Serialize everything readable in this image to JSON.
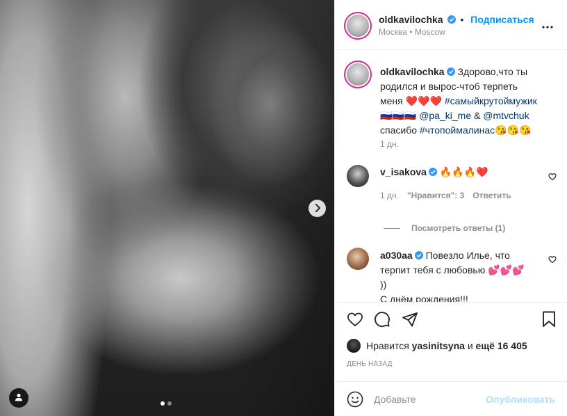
{
  "post_author": {
    "username": "oldkavilochka",
    "follow_label": "Подписаться",
    "location": "Москва • Moscow"
  },
  "caption": {
    "username": "oldkavilochka",
    "text_line1": "Здорово,что ты родился и вырос-чтоб терпеть меня",
    "hearts": "❤️❤️❤️",
    "hashtag1": "#самыйкрутоймужик",
    "flags": "🇷🇺🇷🇺🇷🇺",
    "mention1": "@pa_ki_me",
    "and": "&",
    "mention2": "@mtvchuk",
    "thanks": "спасибо",
    "hashtag2": "#чтопоймалинас",
    "kisses": "😘😘😘",
    "time": "1 дн."
  },
  "comments": [
    {
      "username": "v_isakova",
      "text": "🔥🔥🔥❤️",
      "time": "1 дн.",
      "likes": "\"Нравится\": 3",
      "reply": "Ответить"
    },
    {
      "username": "a030aa",
      "text_line1": "Повезло Илье, что",
      "text_line2": "терпит тебя с любовью 💕💕💕",
      "text_line3": "))",
      "text_line4": "С днём рождения!!!"
    }
  ],
  "view_replies": "Посмотреть ответы (1)",
  "likes": {
    "prefix": "Нравится",
    "user": "yasinitsyna",
    "middle": "и",
    "count": "ещё 16 405"
  },
  "time_ago": "ДЕНЬ НАЗАД",
  "add_comment": {
    "placeholder": "Добавьте",
    "publish": "Опубликовать"
  },
  "carousel": {
    "current": 1,
    "total": 2
  },
  "colors": {
    "accent": "#0095f6",
    "link": "#00376b",
    "muted": "#8e8e8e",
    "heart": "#ed4956"
  }
}
